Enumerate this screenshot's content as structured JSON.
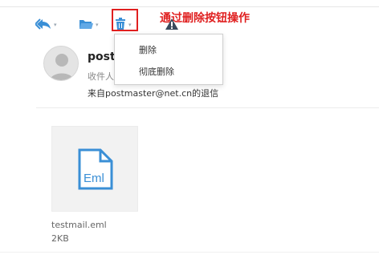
{
  "toolbar": {
    "reply_icon": "reply-all-icon",
    "folder_icon": "folder-move-icon",
    "delete_icon": "trash-icon",
    "dropdown_caret": "▾"
  },
  "annotation": {
    "text": "通过删除按钮操作",
    "color": "#e02020",
    "icon": "alert-triangle-icon"
  },
  "delete_menu": {
    "items": [
      {
        "label": "删除"
      },
      {
        "label": "彻底删除"
      }
    ]
  },
  "message": {
    "sender_name": "postr",
    "recipient_label": "收件人",
    "from_line": "来自postmaster@net.cn的退信"
  },
  "attachment": {
    "icon": "eml-file-icon",
    "icon_text": "Eml",
    "file_name": "testmail.eml",
    "file_size": "2KB"
  },
  "colors": {
    "accent": "#3a8fd6",
    "highlight": "#e02020"
  }
}
